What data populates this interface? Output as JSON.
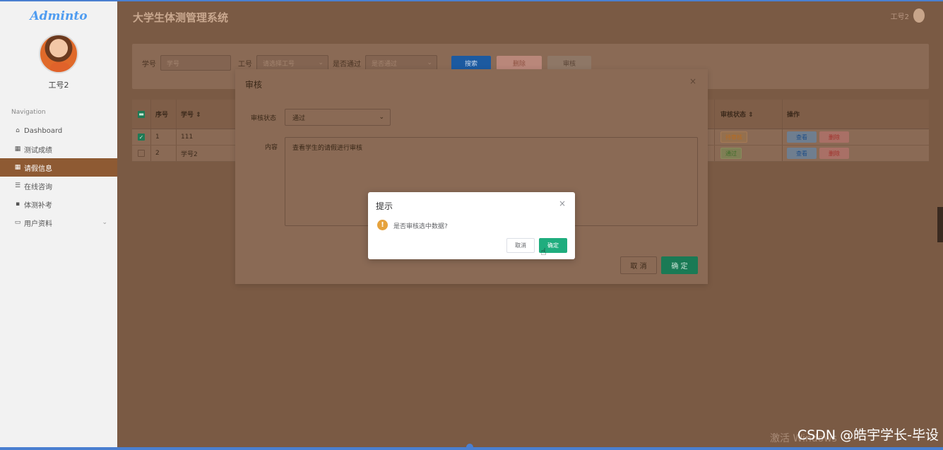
{
  "sidebar": {
    "logo": "Adminto",
    "username": "工号2",
    "nav_title": "Navigation",
    "items": [
      {
        "icon": "⌂",
        "label": "Dashboard"
      },
      {
        "icon": "▦",
        "label": "测试成绩"
      },
      {
        "icon": "▦",
        "label": "请假信息"
      },
      {
        "icon": "☰",
        "label": "在线咨询"
      },
      {
        "icon": "▪",
        "label": "体测补考"
      },
      {
        "icon": "▭",
        "label": "用户资料"
      }
    ]
  },
  "header": {
    "title": "大学生体测管理系统",
    "user": "工号2"
  },
  "search": {
    "label_no": "学号",
    "placeholder_no": "学号",
    "label_work": "工号",
    "placeholder_work": "请选择工号",
    "label_pass": "是否通过",
    "placeholder_pass": "是否通过",
    "btn_search": "搜索",
    "btn_delete": "删除",
    "btn_audit": "审核"
  },
  "table": {
    "headers": {
      "idx": "序号",
      "no": "学号 ⇕",
      "status": "审核状态 ⇕",
      "ops": "操作"
    },
    "rows": [
      {
        "checked": true,
        "idx": "1",
        "no": "111",
        "status": "待审核",
        "view": "查看",
        "del": "删除"
      },
      {
        "checked": false,
        "idx": "2",
        "no": "学号2",
        "status": "通过",
        "view": "查看",
        "del": "删除"
      }
    ]
  },
  "audit_modal": {
    "title": "审核",
    "status_label": "审核状态",
    "status_value": "通过",
    "content_label": "内容",
    "content_value": "查看学生的请假进行审核",
    "cancel": "取 消",
    "ok": "确 定"
  },
  "confirm": {
    "title": "提示",
    "message": "是否审核选中数据?",
    "cancel": "取消",
    "ok": "确定"
  },
  "watermark": "CSDN @皓宇学长-毕设",
  "watermark_win": "激活 Windows"
}
